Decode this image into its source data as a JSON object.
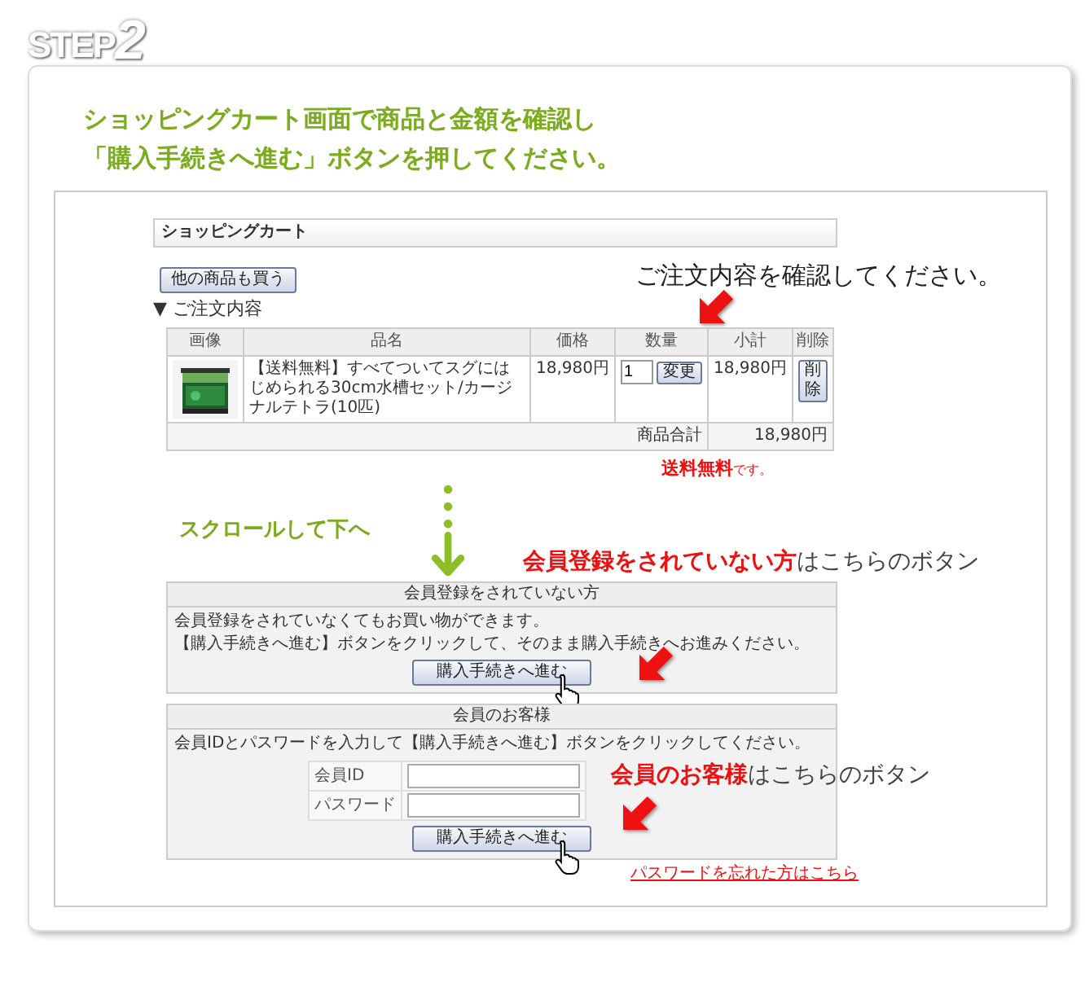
{
  "step": {
    "word": "STEP",
    "number": "2"
  },
  "heading": [
    "ショッピングカート画面で商品と金額を確認し",
    "「購入手続きへ進む」ボタンを押してください。"
  ],
  "cart": {
    "title": "ショッピングカート",
    "continue_button": "他の商品も買う",
    "section_title": "▼ ご注文内容",
    "columns": [
      "画像",
      "品名",
      "価格",
      "数量",
      "小計",
      "削除"
    ],
    "item": {
      "name": "【送料無料】すべてついてスグにはじめられる30cm水槽セット/カージナルテトラ(10匹)",
      "price": "18,980円",
      "quantity": "1",
      "update_button": "変更",
      "subtotal": "18,980円",
      "delete_button": "削除"
    },
    "total": {
      "label": "商品合計",
      "value": "18,980円"
    }
  },
  "shipping_note": "**送料無料**です。",
  "scroll_hint": "スクロールして下へ",
  "guest_box": {
    "title": "会員登録をされていない方",
    "lines": [
      "会員登録をされていなくてもお買い物ができます。",
      "【購入手続きへ進む】ボタンをクリックして、そのまま購入手続きへお進みください。"
    ],
    "button": "購入手続きへ進む"
  },
  "member_box": {
    "title": "会員のお客様",
    "intro": "会員IDとパスワードを入力して【購入手続きへ進む】ボタンをクリックしてください。",
    "fields": [
      {
        "label": "会員ID"
      },
      {
        "label": "パスワード"
      }
    ],
    "button": "購入手続きへ進む",
    "forgot_link": "パスワードを忘れた方はこちら"
  },
  "annotations": [
    {
      "kind": "plain",
      "text": "ご注文内容を確認してください。"
    },
    {
      "kind": "emphasis",
      "text": "**会員登録をされていない方**はこちらのボタン"
    },
    {
      "kind": "emphasis",
      "text": "**会員のお客様**はこちらのボタン"
    }
  ]
}
